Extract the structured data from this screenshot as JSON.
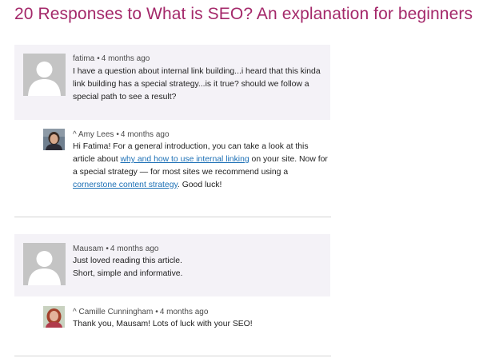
{
  "heading": "20 Responses to What is SEO? An explanation for beginners",
  "comments": [
    {
      "author": "fatima",
      "time": "4 months ago",
      "lines": [
        "I have a question about internal link building...i heard that this kinda",
        "link building has a special strategy...is it true? should we follow a",
        "special path to see a result?"
      ],
      "reply": {
        "author": "^ Amy Lees",
        "time": "4 months ago",
        "text_1": "Hi Fatima! For a general introduction, you can take a look at this",
        "text_2a": "article about ",
        "link_1": "why and how to use internal linking",
        "text_2b": " on your site. Now for",
        "text_3": "a special strategy — for most sites we recommend using a",
        "link_2": "cornerstone content strategy",
        "text_4b": ". Good luck!"
      }
    },
    {
      "author": "Mausam",
      "time": "4 months ago",
      "lines": [
        "Just loved reading this article.",
        "Short, simple and informative."
      ],
      "reply": {
        "author": "^ Camille Cunningham",
        "time": "4 months ago",
        "text_1": "Thank you, Mausam! Lots of luck with your SEO!"
      }
    }
  ],
  "colors": {
    "heading": "#a4286a",
    "link": "#1b6fb5",
    "comment_background": "#f4f2f7",
    "divider": "#d4d4d4"
  }
}
